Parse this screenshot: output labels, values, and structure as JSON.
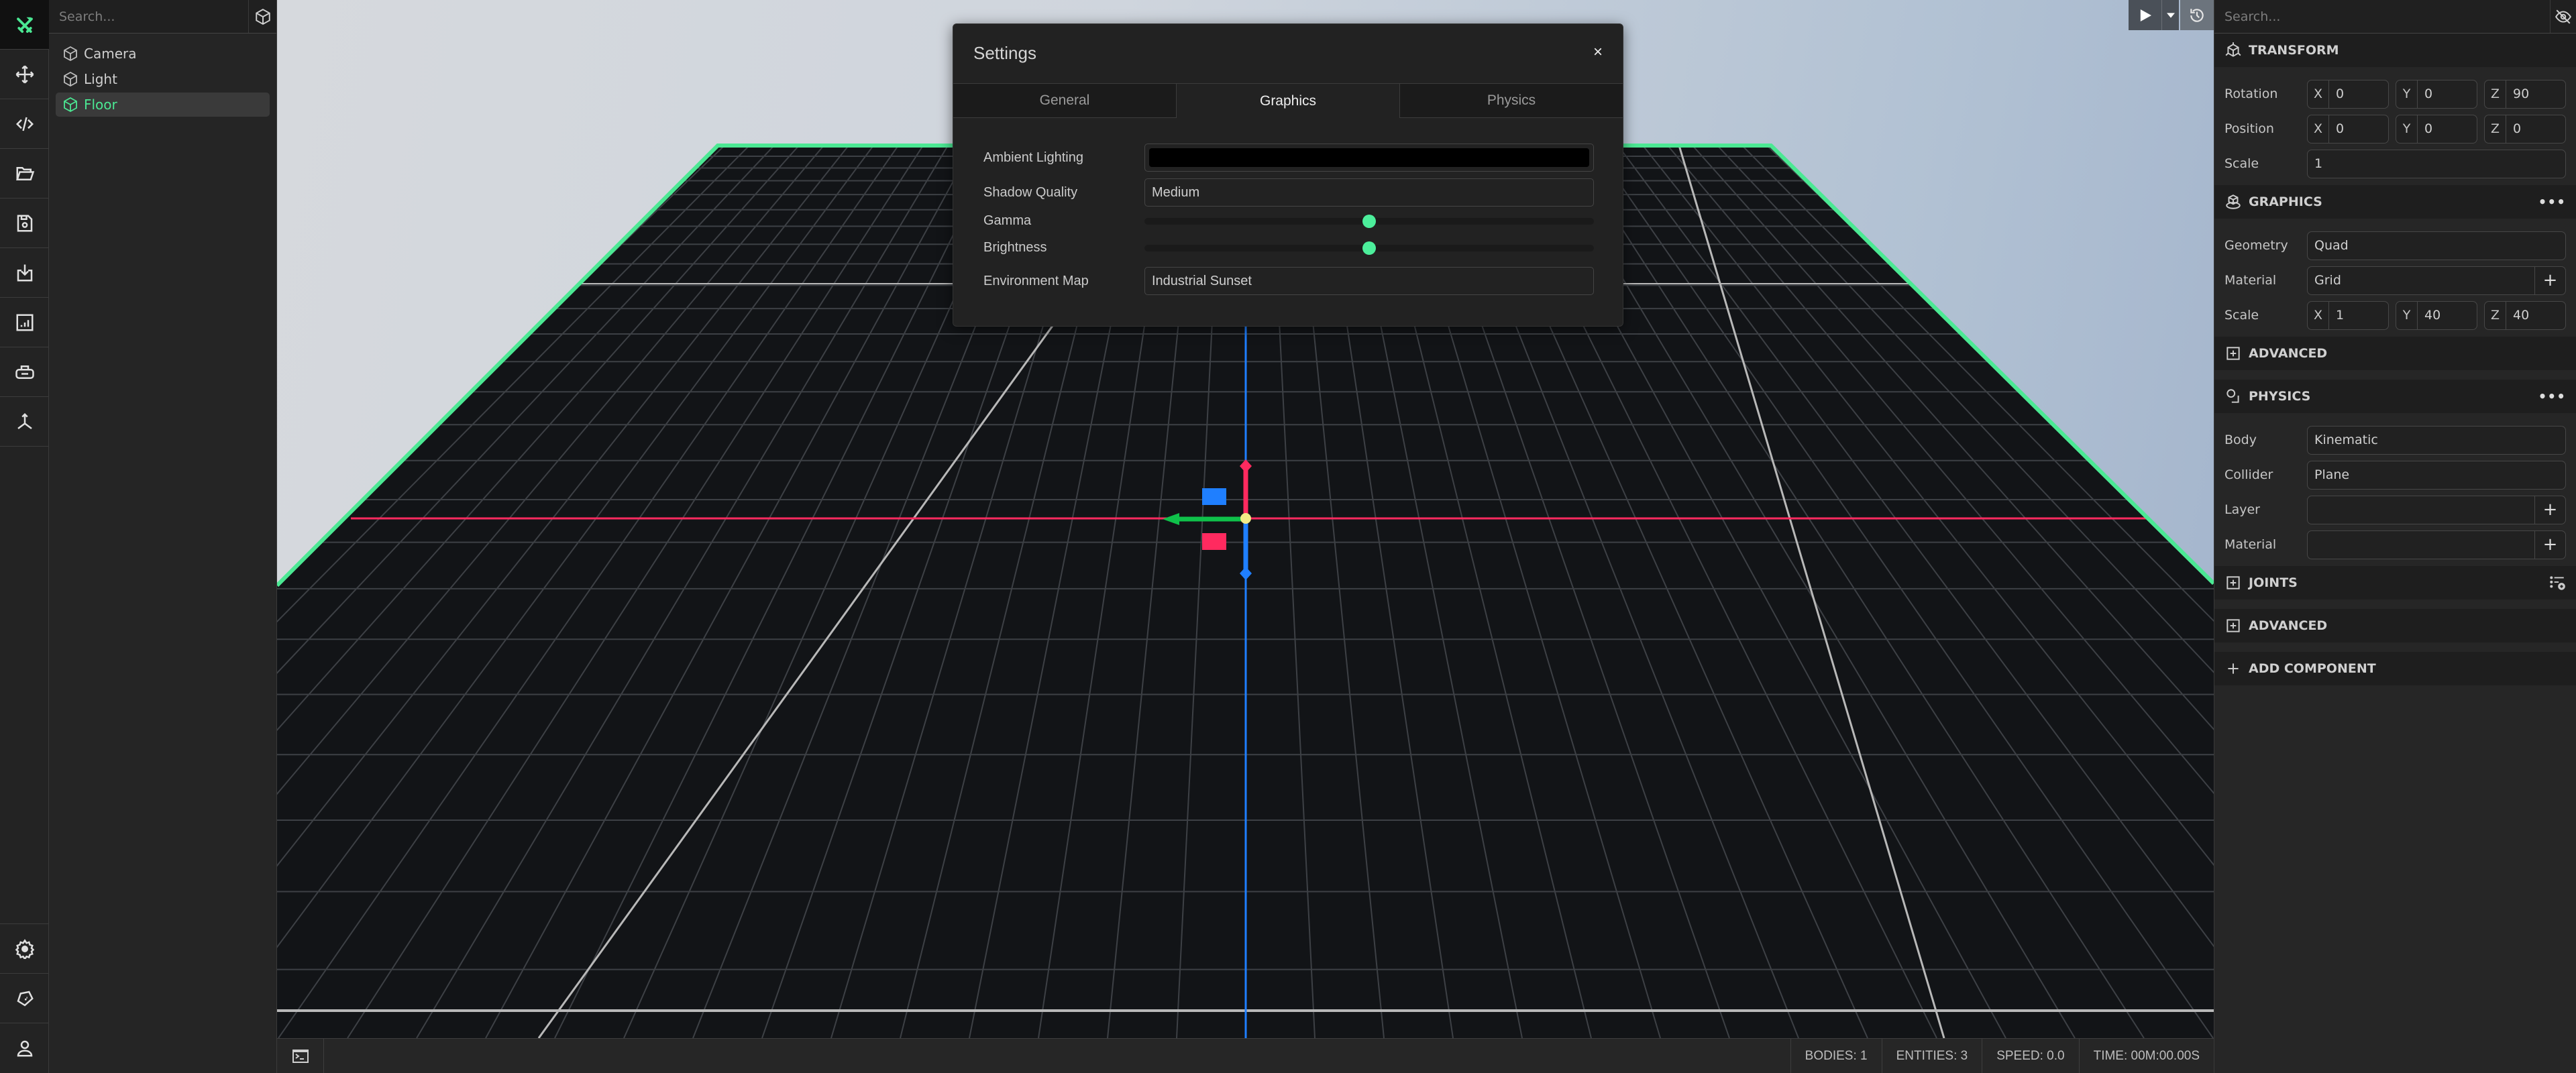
{
  "colors": {
    "accent": "#4be893",
    "axis_x": "#ff2a5f",
    "axis_y": "#1f7fff",
    "axis_z_handle": "#0fc14a",
    "gizmo_center": "#f2ec87"
  },
  "iconbar": {
    "top": [
      {
        "name": "tools-logo-icon"
      },
      {
        "name": "move-icon"
      },
      {
        "name": "code-icon"
      },
      {
        "name": "folder-open-icon"
      },
      {
        "name": "save-icon"
      },
      {
        "name": "import-icon"
      },
      {
        "name": "stats-icon"
      },
      {
        "name": "vr-headset-icon"
      },
      {
        "name": "axes-icon"
      }
    ],
    "bottom": [
      {
        "name": "settings-gear-icon"
      },
      {
        "name": "shape-tag-icon"
      },
      {
        "name": "user-icon"
      }
    ]
  },
  "hierarchy": {
    "search_placeholder": "Search...",
    "items": [
      {
        "label": "Camera",
        "selected": false
      },
      {
        "label": "Light",
        "selected": false
      },
      {
        "label": "Floor",
        "selected": true
      }
    ]
  },
  "viewport": {
    "toolbar": {
      "play": "play-icon",
      "dropdown": "dropdown-caret-icon",
      "history": "history-icon"
    }
  },
  "dialog": {
    "title": "Settings",
    "close": "×",
    "tabs": [
      {
        "label": "General",
        "active": false
      },
      {
        "label": "Graphics",
        "active": true
      },
      {
        "label": "Physics",
        "active": false
      }
    ],
    "fields": {
      "ambient_label": "Ambient Lighting",
      "ambient_color": "#000000",
      "shadow_label": "Shadow Quality",
      "shadow_value": "Medium",
      "gamma_label": "Gamma",
      "gamma_value": 0.5,
      "brightness_label": "Brightness",
      "brightness_value": 0.5,
      "envmap_label": "Environment Map",
      "envmap_value": "Industrial Sunset"
    }
  },
  "inspector": {
    "search_placeholder": "Search...",
    "transform": {
      "title": "TRANSFORM",
      "rotation_label": "Rotation",
      "rotation": {
        "x": "0",
        "y": "0",
        "z": "90"
      },
      "position_label": "Position",
      "position": {
        "x": "0",
        "y": "0",
        "z": "0"
      },
      "scale_label": "Scale",
      "scale": "1"
    },
    "graphics": {
      "title": "GRAPHICS",
      "menu": "•••",
      "geometry_label": "Geometry",
      "geometry": "Quad",
      "material_label": "Material",
      "material": "Grid",
      "scale_label": "Scale",
      "scale": {
        "x": "1",
        "y": "40",
        "z": "40"
      },
      "advanced": "ADVANCED"
    },
    "physics": {
      "title": "PHYSICS",
      "menu": "•••",
      "body_label": "Body",
      "body": "Kinematic",
      "collider_label": "Collider",
      "collider": "Plane",
      "layer_label": "Layer",
      "layer": "",
      "material_label": "Material",
      "material": ""
    },
    "joints": "JOINTS",
    "advanced": "ADVANCED",
    "add_component": "ADD COMPONENT",
    "axis_labels": {
      "x": "X",
      "y": "Y",
      "z": "Z"
    },
    "plus": "+"
  },
  "statusbar": {
    "bodies": "BODIES: 1",
    "entities": "ENTITIES: 3",
    "speed": "SPEED: 0.0",
    "time": "TIME: 00M:00.00S"
  }
}
